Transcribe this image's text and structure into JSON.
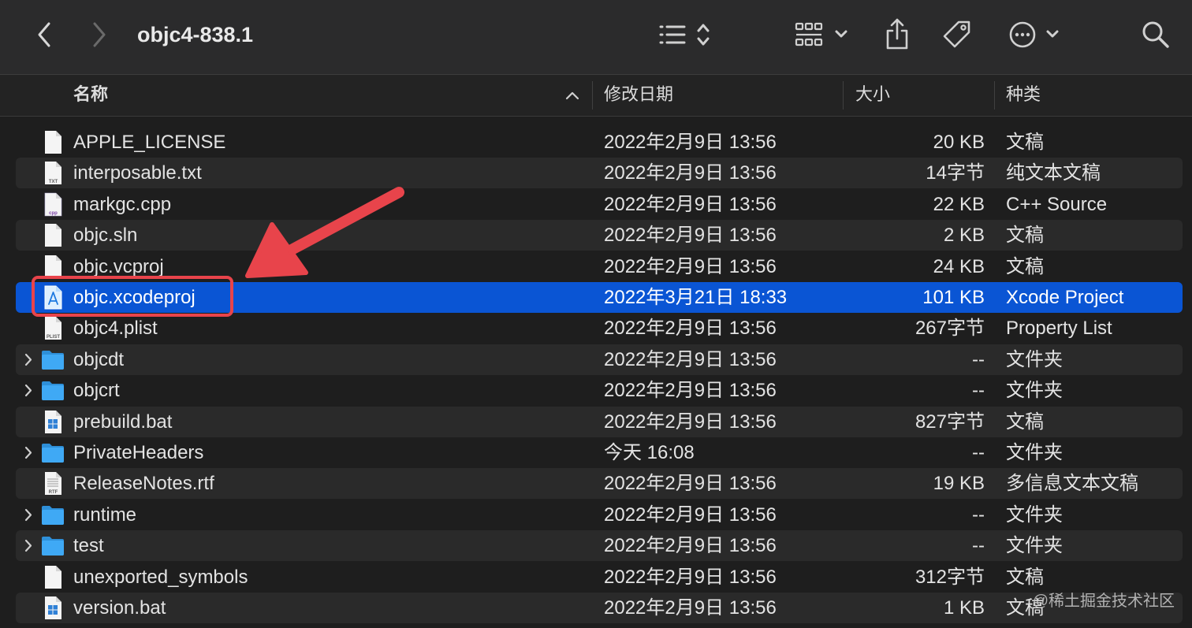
{
  "window": {
    "title": "objc4-838.1"
  },
  "toolbar": {
    "back_icon": "chevron-left-icon",
    "forward_icon": "chevron-right-icon",
    "view_options_icon": "list-view-icon",
    "group_icon": "grid-group-icon",
    "share_icon": "share-icon",
    "tag_icon": "tag-icon",
    "more_icon": "ellipsis-circle-icon",
    "search_icon": "search-icon"
  },
  "header": {
    "name": "名称",
    "date": "修改日期",
    "size": "大小",
    "kind": "种类"
  },
  "colors": {
    "selection": "#0a55d4",
    "folder": "#3fa9f5",
    "annotation": "#e8444b"
  },
  "files": [
    {
      "name": "APPLE_LICENSE",
      "date": "2022年2月9日 13:56",
      "size": "20 KB",
      "kind": "文稿",
      "icon": "doc",
      "folder": false
    },
    {
      "name": "interposable.txt",
      "date": "2022年2月9日 13:56",
      "size": "14字节",
      "kind": "纯文本文稿",
      "icon": "txt",
      "folder": false
    },
    {
      "name": "markgc.cpp",
      "date": "2022年2月9日 13:56",
      "size": "22 KB",
      "kind": "C++ Source",
      "icon": "cpp",
      "folder": false
    },
    {
      "name": "objc.sln",
      "date": "2022年2月9日 13:56",
      "size": "2 KB",
      "kind": "文稿",
      "icon": "doc",
      "folder": false
    },
    {
      "name": "objc.vcproj",
      "date": "2022年2月9日 13:56",
      "size": "24 KB",
      "kind": "文稿",
      "icon": "doc",
      "folder": false
    },
    {
      "name": "objc.xcodeproj",
      "date": "2022年3月21日 18:33",
      "size": "101 KB",
      "kind": "Xcode Project",
      "icon": "xcode",
      "folder": false,
      "selected": true
    },
    {
      "name": "objc4.plist",
      "date": "2022年2月9日 13:56",
      "size": "267字节",
      "kind": "Property List",
      "icon": "plist",
      "folder": false
    },
    {
      "name": "objcdt",
      "date": "2022年2月9日 13:56",
      "size": "--",
      "kind": "文件夹",
      "icon": "folder",
      "folder": true
    },
    {
      "name": "objcrt",
      "date": "2022年2月9日 13:56",
      "size": "--",
      "kind": "文件夹",
      "icon": "folder",
      "folder": true
    },
    {
      "name": "prebuild.bat",
      "date": "2022年2月9日 13:56",
      "size": "827字节",
      "kind": "文稿",
      "icon": "bat",
      "folder": false
    },
    {
      "name": "PrivateHeaders",
      "date": "今天 16:08",
      "size": "--",
      "kind": "文件夹",
      "icon": "folder",
      "folder": true
    },
    {
      "name": "ReleaseNotes.rtf",
      "date": "2022年2月9日 13:56",
      "size": "19 KB",
      "kind": "多信息文本文稿",
      "icon": "rtf",
      "folder": false
    },
    {
      "name": "runtime",
      "date": "2022年2月9日 13:56",
      "size": "--",
      "kind": "文件夹",
      "icon": "folder",
      "folder": true
    },
    {
      "name": "test",
      "date": "2022年2月9日 13:56",
      "size": "--",
      "kind": "文件夹",
      "icon": "folder",
      "folder": true
    },
    {
      "name": "unexported_symbols",
      "date": "2022年2月9日 13:56",
      "size": "312字节",
      "kind": "文稿",
      "icon": "doc",
      "folder": false
    },
    {
      "name": "version.bat",
      "date": "2022年2月9日 13:56",
      "size": "1 KB",
      "kind": "文稿",
      "icon": "bat",
      "folder": false
    }
  ],
  "icon_labels": {
    "txt": "TXT",
    "cpp": "cpp",
    "plist": "PLIST",
    "rtf": "RTF"
  },
  "watermark": "@稀土掘金技术社区"
}
